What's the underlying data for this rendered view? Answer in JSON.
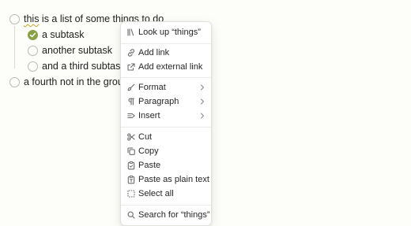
{
  "tasks": [
    {
      "text": "this is a list of some things to do",
      "checked": false
    },
    {
      "text": "a subtask",
      "checked": true
    },
    {
      "text": "another subtask",
      "checked": false
    },
    {
      "text": "and a third subtask",
      "checked": false
    },
    {
      "text": "a fourth not in the group",
      "checked": false
    }
  ],
  "squiggle_word": "this",
  "squiggle_rest": " is a list of some things to do",
  "context_menu": {
    "lookup": "Look up “things”",
    "add_link": "Add link",
    "add_external_link": "Add external link",
    "format": "Format",
    "paragraph": "Paragraph",
    "insert": "Insert",
    "cut": "Cut",
    "copy": "Copy",
    "paste": "Paste",
    "paste_plain": "Paste as plain text",
    "select_all": "Select all",
    "search": "Search for “things”"
  },
  "colors": {
    "check_fill": "#8aa046",
    "squiggle": "#c9a227",
    "background": "#fdfdf9"
  }
}
